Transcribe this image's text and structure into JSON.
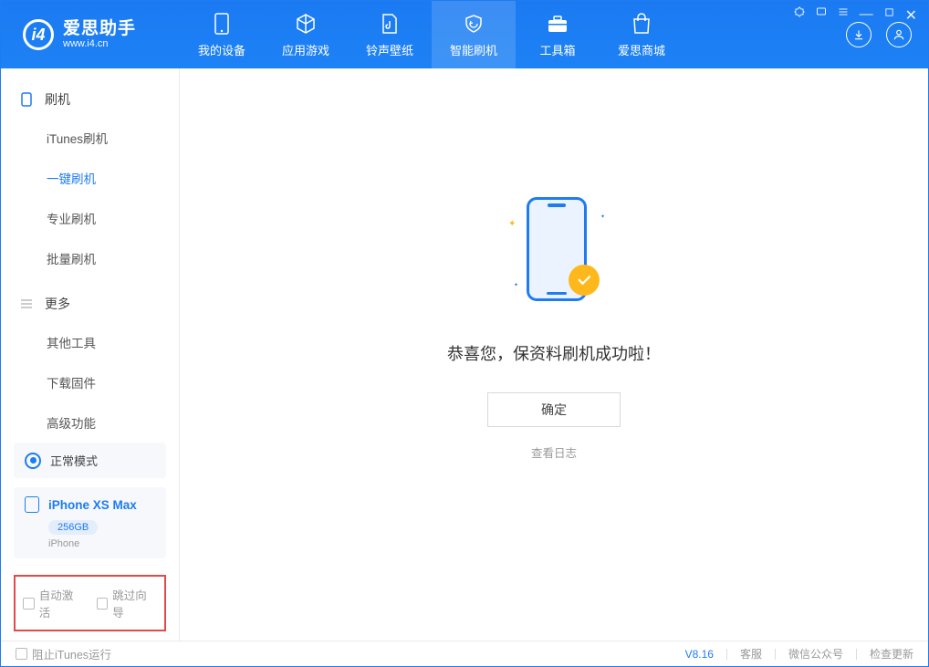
{
  "app": {
    "title": "爱思助手",
    "subtitle": "www.i4.cn"
  },
  "tabs": [
    {
      "label": "我的设备"
    },
    {
      "label": "应用游戏"
    },
    {
      "label": "铃声壁纸"
    },
    {
      "label": "智能刷机"
    },
    {
      "label": "工具箱"
    },
    {
      "label": "爱思商城"
    }
  ],
  "sidebar": {
    "section1": {
      "title": "刷机"
    },
    "items1": [
      {
        "label": "iTunes刷机"
      },
      {
        "label": "一键刷机"
      },
      {
        "label": "专业刷机"
      },
      {
        "label": "批量刷机"
      }
    ],
    "section2": {
      "title": "更多"
    },
    "items2": [
      {
        "label": "其他工具"
      },
      {
        "label": "下载固件"
      },
      {
        "label": "高级功能"
      }
    ],
    "mode": "正常模式",
    "device": {
      "name": "iPhone XS Max",
      "capacity": "256GB",
      "type": "iPhone"
    },
    "cb1": "自动激活",
    "cb2": "跳过向导"
  },
  "main": {
    "success": "恭喜您，保资料刷机成功啦！",
    "ok": "确定",
    "view_log": "查看日志"
  },
  "footer": {
    "block_itunes": "阻止iTunes运行",
    "version": "V8.16",
    "support": "客服",
    "wechat": "微信公众号",
    "update": "检查更新"
  }
}
